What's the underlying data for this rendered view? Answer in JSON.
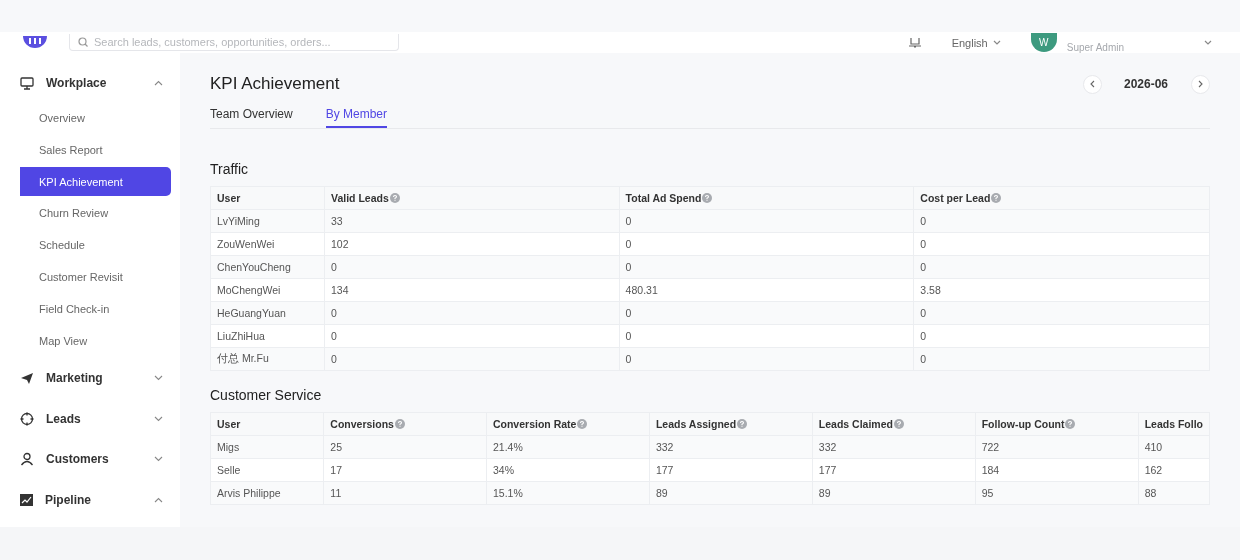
{
  "header": {
    "search": {
      "placeholder": "Search leads, customers, opportunities, orders..."
    },
    "language": "English",
    "user": {
      "avatar": "W",
      "role": "Super Admin"
    }
  },
  "sidebar": {
    "groups": [
      {
        "label": "Workplace",
        "expanded": true,
        "children": [
          {
            "label": "Overview",
            "selected": false
          },
          {
            "label": "Sales Report",
            "selected": false
          },
          {
            "label": "KPI Achievement",
            "selected": true
          },
          {
            "label": "Churn Review",
            "selected": false
          },
          {
            "label": "Schedule",
            "selected": false
          },
          {
            "label": "Customer Revisit",
            "selected": false
          },
          {
            "label": "Field Check-in",
            "selected": false
          },
          {
            "label": "Map View",
            "selected": false
          }
        ]
      },
      {
        "label": "Marketing",
        "expanded": false
      },
      {
        "label": "Leads",
        "expanded": false
      },
      {
        "label": "Customers",
        "expanded": false
      },
      {
        "label": "Pipeline",
        "expanded": true
      }
    ]
  },
  "page": {
    "title": "KPI Achievement",
    "period": "2026-06",
    "tabs": [
      {
        "label": "Team Overview",
        "selected": false
      },
      {
        "label": "By Member",
        "selected": true
      }
    ]
  },
  "sections": [
    {
      "title": "Traffic",
      "columns": [
        {
          "label": "User",
          "help": false
        },
        {
          "label": "Valid Leads",
          "help": true
        },
        {
          "label": "Total Ad Spend",
          "help": true
        },
        {
          "label": "Cost per Lead",
          "help": true
        }
      ],
      "rows": [
        [
          "LvYiMing",
          "33",
          "0",
          "0"
        ],
        [
          "ZouWenWei",
          "102",
          "0",
          "0"
        ],
        [
          "ChenYouCheng",
          "0",
          "0",
          "0"
        ],
        [
          "MoChengWei",
          "134",
          "480.31",
          "3.58"
        ],
        [
          "HeGuangYuan",
          "0",
          "0",
          "0"
        ],
        [
          "LiuZhiHua",
          "0",
          "0",
          "0"
        ],
        [
          "付总 Mr.Fu",
          "0",
          "0",
          "0"
        ]
      ]
    },
    {
      "title": "Customer Service",
      "columns": [
        {
          "label": "User",
          "help": false
        },
        {
          "label": "Conversions",
          "help": true
        },
        {
          "label": "Conversion Rate",
          "help": true
        },
        {
          "label": "Leads Assigned",
          "help": true
        },
        {
          "label": "Leads Claimed",
          "help": true
        },
        {
          "label": "Follow-up Count",
          "help": true
        },
        {
          "label": "Leads Follo",
          "help": false
        }
      ],
      "rows": [
        [
          "Migs",
          "25",
          "21.4%",
          "332",
          "332",
          "722",
          "410"
        ],
        [
          "Selle",
          "17",
          "34%",
          "177",
          "177",
          "184",
          "162"
        ],
        [
          "Arvis Philippe",
          "11",
          "15.1%",
          "89",
          "89",
          "95",
          "88"
        ]
      ]
    }
  ]
}
